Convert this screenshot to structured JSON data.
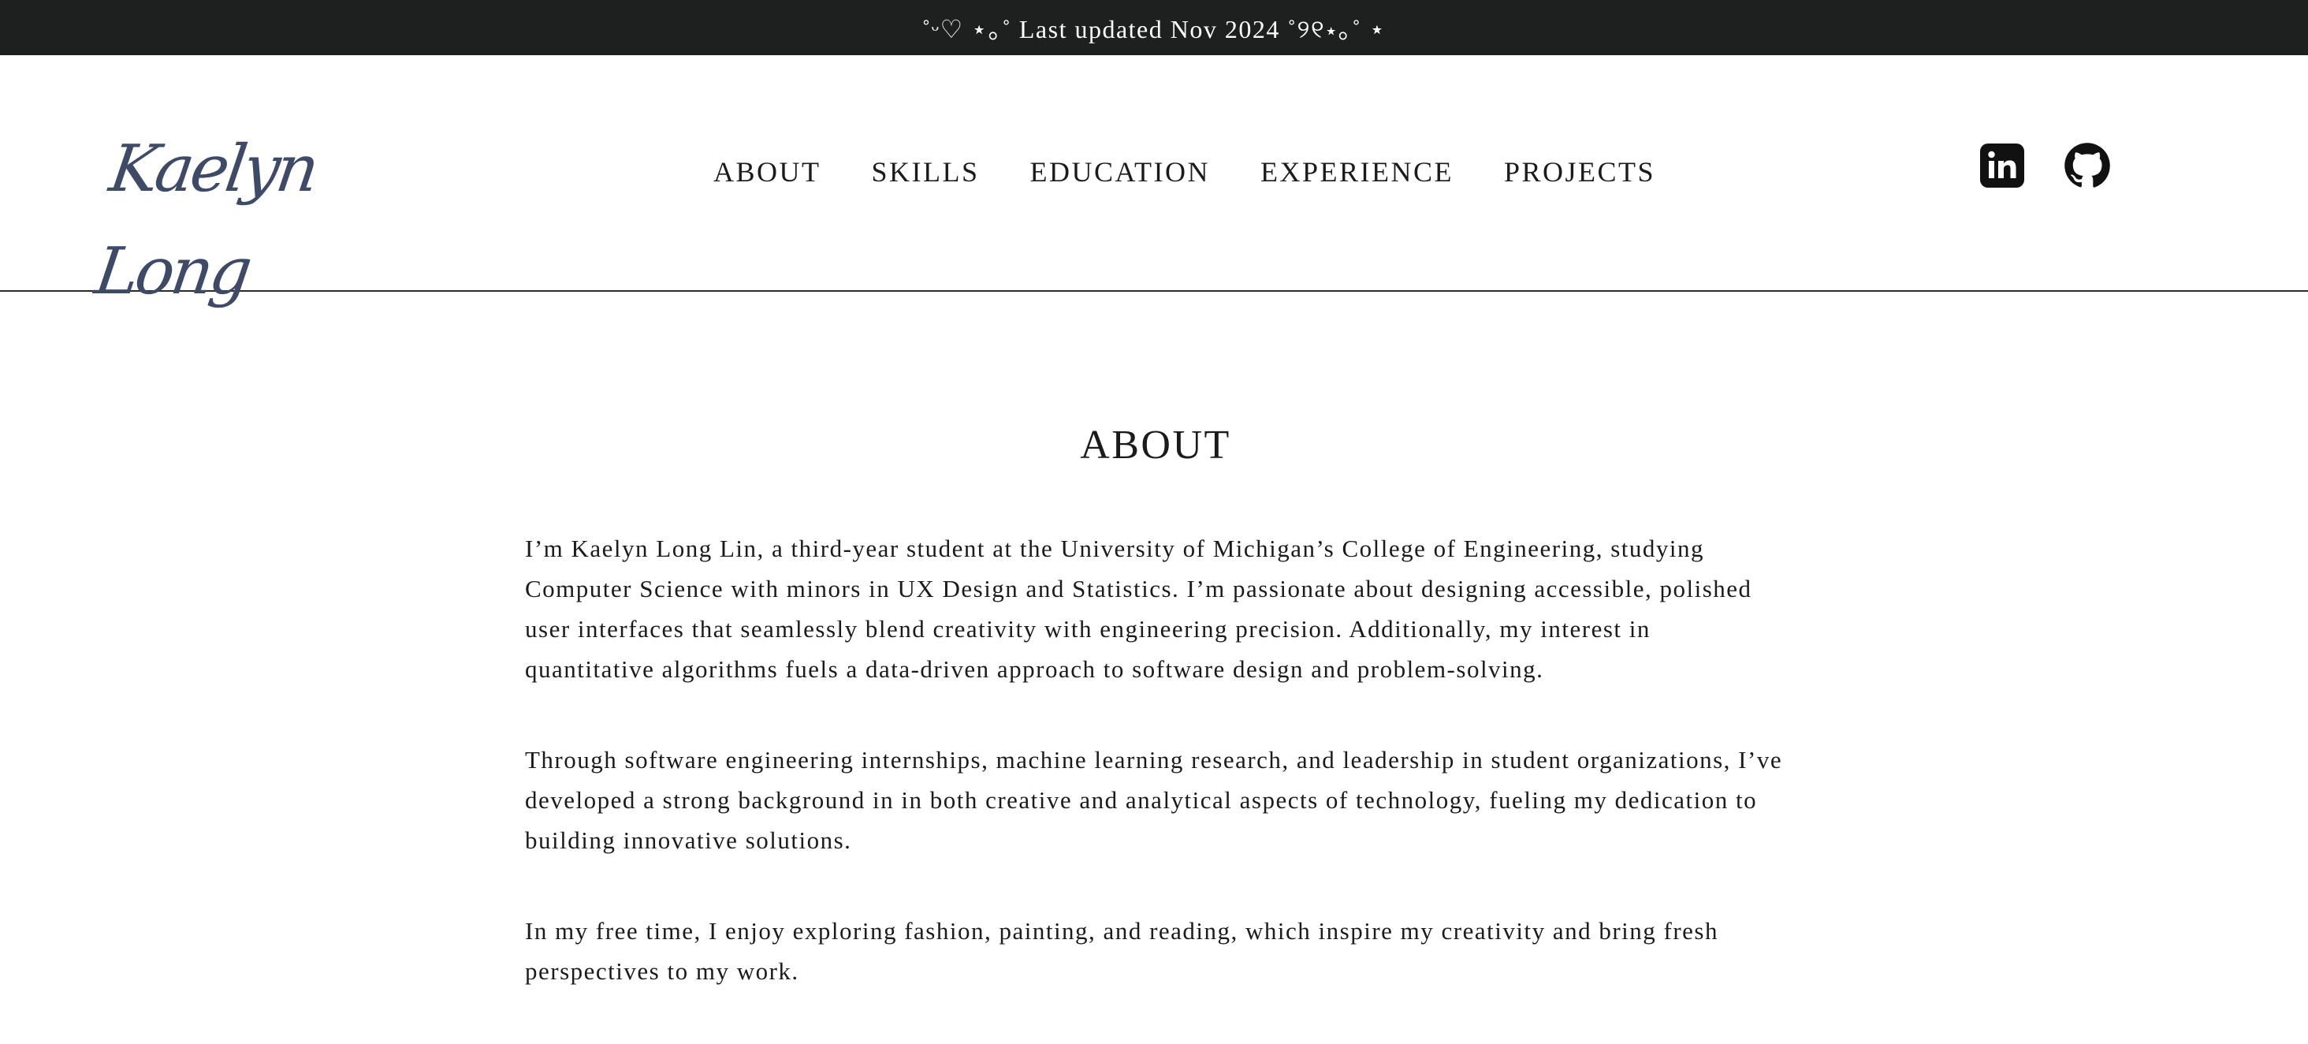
{
  "announcement": {
    "text": "˚ᵕ♡ ⋆｡˚ Last updated Nov 2024 ˚୨୧⋆｡˚ ⋆"
  },
  "header": {
    "logo_text": "Kaelyn Long",
    "nav": [
      {
        "label": "ABOUT"
      },
      {
        "label": "SKILLS"
      },
      {
        "label": "EDUCATION"
      },
      {
        "label": "EXPERIENCE"
      },
      {
        "label": "PROJECTS"
      }
    ],
    "social": [
      {
        "icon": "linkedin-icon"
      },
      {
        "icon": "github-icon"
      }
    ]
  },
  "about": {
    "title": "ABOUT",
    "paragraphs": [
      "I’m Kaelyn Long Lin, a third-year student at the University of Michigan’s College of Engineering, studying Computer Science with minors in UX Design and Statistics. I’m passionate about designing accessible, polished user interfaces that seamlessly blend creativity with engineering precision. Additionally, my interest in quantitative algorithms fuels a data-driven approach to software design and problem-solving.",
      "Through software engineering internships, machine learning research, and leadership in student organizations, I’ve developed a strong background in in both creative and analytical aspects of technology, fueling my dedication to building innovative solutions.",
      "In my free time, I enjoy exploring fashion, painting, and reading, which inspire my creativity and bring fresh perspectives to my work."
    ]
  }
}
